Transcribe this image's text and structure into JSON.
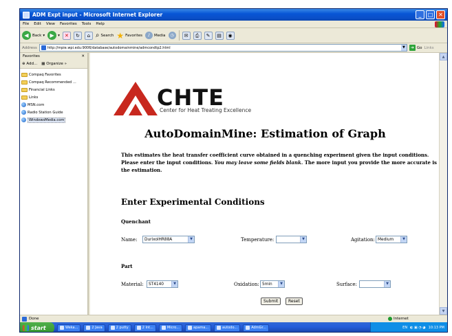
{
  "window": {
    "title": "ADM Expt input - Microsoft Internet Explorer",
    "controls": {
      "minimize": "_",
      "maximize": "□",
      "close": "✕"
    }
  },
  "menu": [
    "File",
    "Edit",
    "View",
    "Favorites",
    "Tools",
    "Help"
  ],
  "toolbar": {
    "back": "Back",
    "search": "Search",
    "favorites": "Favorites",
    "media": "Media"
  },
  "address": {
    "label": "Address",
    "url": "http://mpie.wpi.edu:9006/database/autodomainmine/admcondtp2.html",
    "go": "Go",
    "links": "Links"
  },
  "favorites_panel": {
    "title": "Favorites",
    "close": "✕",
    "add": "Add...",
    "organize": "Organize",
    "items": [
      {
        "label": "Compaq Favorites",
        "icon": "folder-icon"
      },
      {
        "label": "Compaq Recommended ...",
        "icon": "folder-icon"
      },
      {
        "label": "Financial Links",
        "icon": "folder-icon"
      },
      {
        "label": "Links",
        "icon": "folder-icon"
      },
      {
        "label": "MSN.com",
        "icon": "globe-icon"
      },
      {
        "label": "Radio Station Guide",
        "icon": "globe-icon"
      },
      {
        "label": "WindowsMedia.com",
        "icon": "globe-icon"
      }
    ]
  },
  "page": {
    "logo_text": "CHTE",
    "logo_subtitle": "Center for Heat Treating Excellence",
    "title": "AutoDomainMine: Estimation of Graph",
    "intro_part1": "This estimates the heat transfer coefficient curve obtained in a quenching experiment given the input conditions. Please enter the input conditions.",
    "intro_italic": "You may leave some fields blank.",
    "intro_part2": "The more input you provide the more accurate is the estimation.",
    "section_title": "Enter Experimental Conditions",
    "quenchant": {
      "heading": "Quenchant",
      "name_label": "Name:",
      "name_value": "DurixolHR88A",
      "temperature_label": "Temperature:",
      "temperature_value": "",
      "agitation_label": "Agitation:",
      "agitation_value": "Medium"
    },
    "part": {
      "heading": "Part",
      "material_label": "Material:",
      "material_value": "ST4140",
      "oxidation_label": "Oxidation:",
      "oxidation_value": "5min",
      "surface_label": "Surface:",
      "surface_value": ""
    },
    "submit": "Submit",
    "reset": "Reset"
  },
  "status": {
    "left": "Done",
    "zone": "Internet"
  },
  "taskbar": {
    "start": "start",
    "tasks": [
      "Weka...",
      "2 Java",
      "2 putty",
      "2 Int...",
      "Micro...",
      "apama...",
      "autodo...",
      "AdmGr..."
    ],
    "tray_lang": "EN",
    "clock": "10:13 PM"
  },
  "colors": {
    "logo_red": "#c8281e",
    "titlebar_blue": "#0856d6",
    "taskbar_blue": "#245edb",
    "start_green": "#37962e"
  }
}
